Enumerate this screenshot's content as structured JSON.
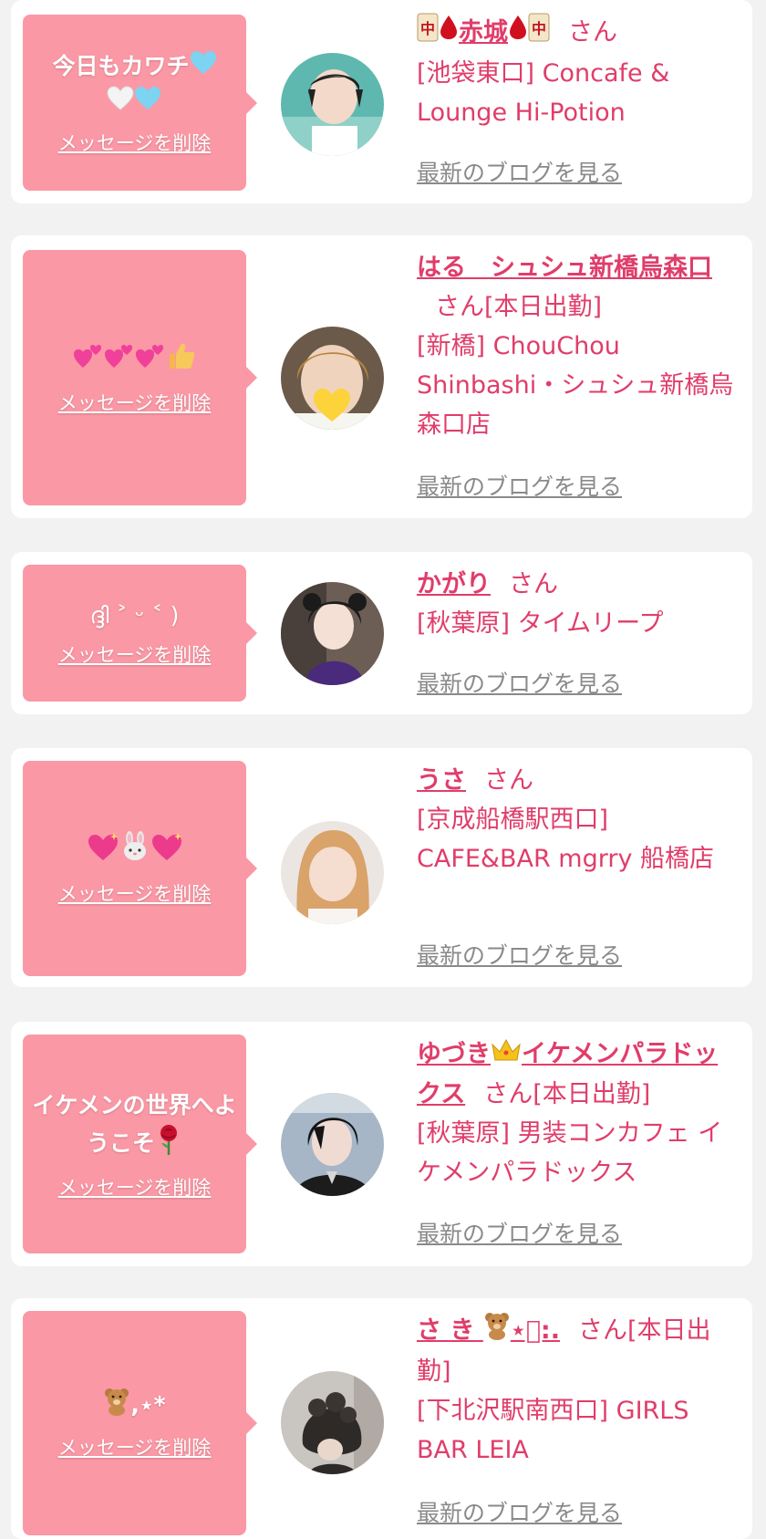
{
  "common": {
    "delete_label": "メッセージを削除",
    "blog_label": "最新のブログを見る",
    "san_label": "さん"
  },
  "colors": {
    "message_bg": "#fb98a5",
    "accent": "#e03d6a",
    "blog_link": "#8a8a8a",
    "page_bg": "#f2f2f2"
  },
  "cards": [
    {
      "message": "今日もカワチ",
      "message_icons": [
        "light-blue-heart-icon",
        "white-heart-icon",
        "light-blue-heart-icon"
      ],
      "name": "赤城",
      "name_icons": [
        "mahjong-red-dragon-icon",
        "drop-of-blood-icon",
        "drop-of-blood-icon",
        "mahjong-red-dragon-icon"
      ],
      "suffix": "",
      "shop": "[池袋東口] Concafe & Lounge Hi-Potion"
    },
    {
      "message": "",
      "message_icons": [
        "two-hearts-icon",
        "two-hearts-icon",
        "two-hearts-icon",
        "thumbs-up-icon"
      ],
      "name": "はる　シュシュ新橋烏森口",
      "name_icons": [],
      "suffix": "[本日出勤]",
      "shop": "[新橋] ChouChou Shinbashi・シュシュ新橋烏森口店"
    },
    {
      "message": "ദ്ദി ˃ ᵕ ˂ )",
      "message_icons": [],
      "name": "かがり",
      "name_icons": [],
      "suffix": "",
      "shop": "[秋葉原] タイムリープ"
    },
    {
      "message": "",
      "message_icons": [
        "sparkling-heart-icon",
        "rabbit-face-icon",
        "sparkling-heart-icon"
      ],
      "name": "うさ",
      "name_icons": [],
      "suffix": "",
      "shop": "[京成船橋駅西口] CAFE&BAR mgrry 船橋店"
    },
    {
      "message": "イケメンの世界へようこそ",
      "message_icons": [
        "rose-icon"
      ],
      "name": "ゆづき",
      "name_after": "イケメンパラドックス",
      "name_icons": [
        "crown-icon"
      ],
      "suffix": "[本日出勤]",
      "shop": "[秋葉原] 男装コンカフェ イケメンパラドックス"
    },
    {
      "message": ",⋆*",
      "message_icons": [
        "teddy-bear-icon"
      ],
      "name": "さ き",
      "name_after": "⋆͛:.",
      "name_icons": [
        "teddy-bear-icon"
      ],
      "suffix": "[本日出勤]",
      "shop": "[下北沢駅南西口] GIRLS BAR LEIA"
    }
  ]
}
